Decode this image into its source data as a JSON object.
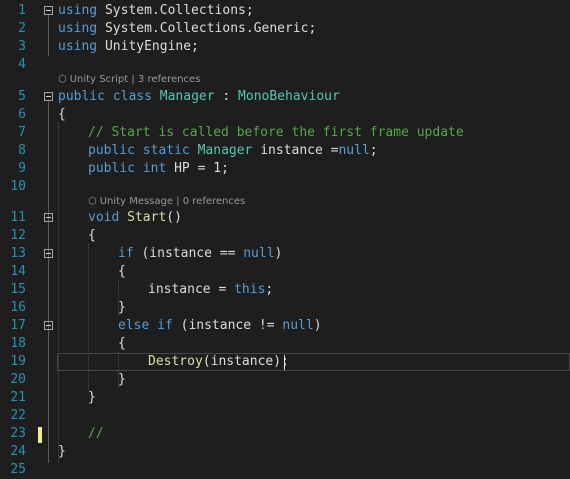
{
  "editor": {
    "line_numbers": [
      "1",
      "2",
      "3",
      "4",
      "5",
      "6",
      "7",
      "8",
      "9",
      "10",
      "11",
      "12",
      "13",
      "14",
      "15",
      "16",
      "17",
      "18",
      "19",
      "20",
      "21",
      "22",
      "23",
      "24",
      "25"
    ],
    "codelens": {
      "class": {
        "icon": "unity-icon",
        "text": "Unity Script | 3 references"
      },
      "method": {
        "icon": "unity-icon",
        "text": "Unity Message | 0 references"
      }
    },
    "lines": {
      "l1": {
        "kw": "using",
        "rest": " System.Collections;"
      },
      "l2": {
        "kw": "using",
        "rest": " System.Collections.Generic;"
      },
      "l3": {
        "kw": "using",
        "rest": " UnityEngine;"
      },
      "l5": {
        "kw1": "public",
        "kw2": " class",
        "name": " Manager",
        "sep": " : ",
        "base": "MonoBehaviour"
      },
      "l6": "{",
      "l7": "// Start is called before the first frame update",
      "l8": {
        "kw1": "public",
        "kw2": " static",
        "type": " Manager",
        "rest1": " instance =",
        "kw3": "null",
        "rest2": ";"
      },
      "l9": {
        "kw1": "public",
        "kw2": " int",
        "rest": " HP = 1;"
      },
      "l11": {
        "kw": "void",
        "fn": " Start",
        "rest": "()"
      },
      "l12": "{",
      "l13": {
        "kw": "if",
        "rest1": " (instance == ",
        "kw2": "null",
        "rest2": ")"
      },
      "l14": "{",
      "l15": {
        "rest1": "instance = ",
        "kw": "this",
        "rest2": ";"
      },
      "l16": "}",
      "l17": {
        "kw1": "else",
        "kw2": " if",
        "rest1": " (instance != ",
        "kw3": "null",
        "rest2": ")"
      },
      "l18": "{",
      "l19": {
        "fn": "Destroy",
        "rest": "(instance);"
      },
      "l20": "}",
      "l21": "}",
      "l23": "//",
      "l24": "}"
    }
  }
}
